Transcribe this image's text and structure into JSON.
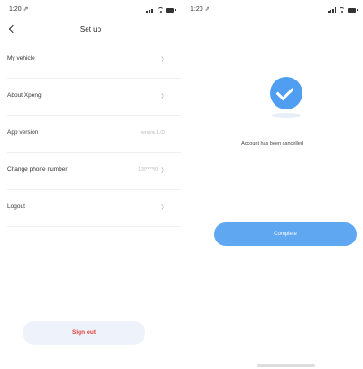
{
  "left": {
    "status": {
      "time": "1:20 ⇗"
    },
    "title": "Set up",
    "items": [
      {
        "label": "My vehicle",
        "value": ""
      },
      {
        "label": "About Xpeng",
        "value": ""
      },
      {
        "label": "App version",
        "value": "version 1.00"
      },
      {
        "label": "Change phone number",
        "value": "138****00"
      },
      {
        "label": "Logout",
        "value": ""
      }
    ],
    "sign_out": "Sign out"
  },
  "right": {
    "status": {
      "time": "1:20 ⇗"
    },
    "message": "Account has been cancelled",
    "complete": "Complete"
  },
  "colors": {
    "accent": "#5fa8f1",
    "danger": "#e0443a",
    "check": "#4f9ef1"
  }
}
